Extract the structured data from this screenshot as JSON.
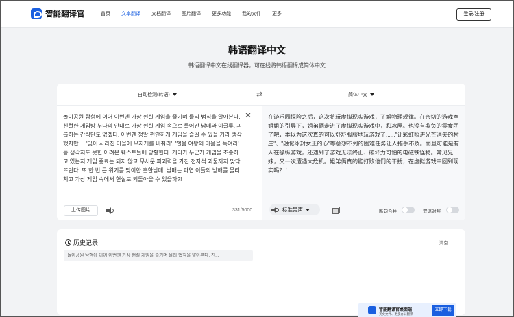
{
  "header": {
    "app_name": "智能翻译官",
    "nav": [
      "首页",
      "文本翻译",
      "文档翻译",
      "图片翻译",
      "更多功能",
      "我的文件",
      "更多"
    ],
    "active_nav_index": 1,
    "login": "登录/注册"
  },
  "page": {
    "title": "韩语翻译中文",
    "subtitle": "韩语翻译中文在线翻译器，可在线将韩语翻译成简体中文"
  },
  "translator": {
    "source_lang": "自动检测(韩语)",
    "target_lang": "简体中文",
    "source_text": "놀이공원 탐험에 이어 이번엔 가상 현실 게임을 즐기며 물리 법칙을 알아본다. 친절한 게임방 누나의 안내로 가상 현실 게임 속으로 들어간 남매와 이글루, 괴롭히는 간식단도 없겠다, 이번엔 정말 편안하게 게임을 즐길 수 있을 거라 생각했지만.... '빛이 사라진 마을에 무지개를 비춰라', '얼음 여왕의 마음을 녹여라' 등 생각지도 못한 어려운 퀘스트들에 당황한다. 게다가 누군가 게임을 조종하고 있는지 게임 종료는 되지 않고 무서운 파괴력을 가진 전자석 괴물까지 맞닥뜨린다. 또 한 번 큰 위기를 맞이한 흔한남매. 남매는 과연 이들의 방해를 물리치고 가상 게임 속에서 현실로 되돌아올 수 있을까?!",
    "target_text": "在游乐园探险之后，这次将玩虚拟现实游戏，了解物理规律。在亲切的游戏室姐姐的引导下，姐弟俩走进了虚拟现实游戏中，和冰屋。也没有欺负的零食团了吧，本以为这次真的可以舒舒服服地玩游戏了......\"让彩虹照进光芒消失的村庄\"、\"融化冰封女王的心\"等意想不到的困难任务让人措手不及。而且可能是有人在操纵游戏，还遇到了游戏无法终止、破坏力可怕的电磁铁怪物。常见兄妹，又一次遭遇大危机。姐弟俩真的能打败他们的干扰，在虚拟游戏中回到现实吗？！",
    "upload_label": "上传图片",
    "char_count": "331/5000",
    "voice_label": "标准男声",
    "toggle_split": "断句合并",
    "toggle_bilingual": "双语对照"
  },
  "history": {
    "title": "历史记录",
    "clear": "清空",
    "items": [
      "놀이공원 탐험에 이어 이번엔 가상 현실 게임을 즐기며 물리 법칙을 알아본다. 친..."
    ]
  },
  "promo": {
    "title": "智能翻译官桌面端",
    "subtitle": "英文文件、更多办公翻译",
    "button": "立即下载"
  }
}
